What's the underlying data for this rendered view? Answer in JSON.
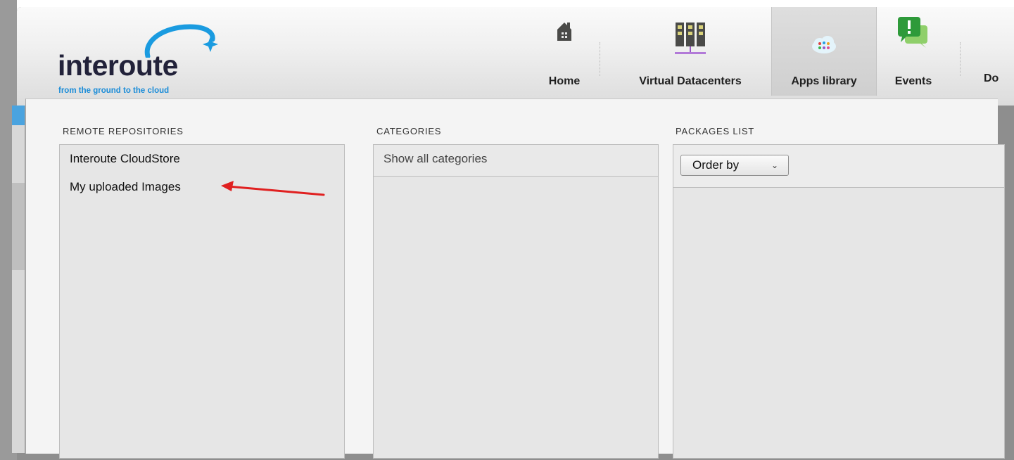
{
  "logo": {
    "name": "interoute",
    "tagline": "from the ground to the cloud"
  },
  "nav": {
    "tabs": [
      {
        "label": "Home",
        "icon": "home-icon",
        "active": false
      },
      {
        "label": "Virtual Datacenters",
        "icon": "datacenter-icon",
        "active": false
      },
      {
        "label": "Apps library",
        "icon": "apps-library-icon",
        "active": true
      },
      {
        "label": "Events",
        "icon": "events-icon",
        "active": false
      },
      {
        "label": "Do",
        "icon": "",
        "active": false
      }
    ]
  },
  "panels": {
    "repositories": {
      "title": "REMOTE REPOSITORIES",
      "items": [
        "Interoute CloudStore",
        "My uploaded Images"
      ]
    },
    "categories": {
      "title": "CATEGORIES",
      "show_all": "Show all categories"
    },
    "packages": {
      "title": "PACKAGES LIST",
      "order_by": "Order by"
    }
  },
  "colors": {
    "brand_blue": "#1a8cd8",
    "annotation_arrow": "#e02020",
    "panel_bg": "#e6e6e6"
  }
}
